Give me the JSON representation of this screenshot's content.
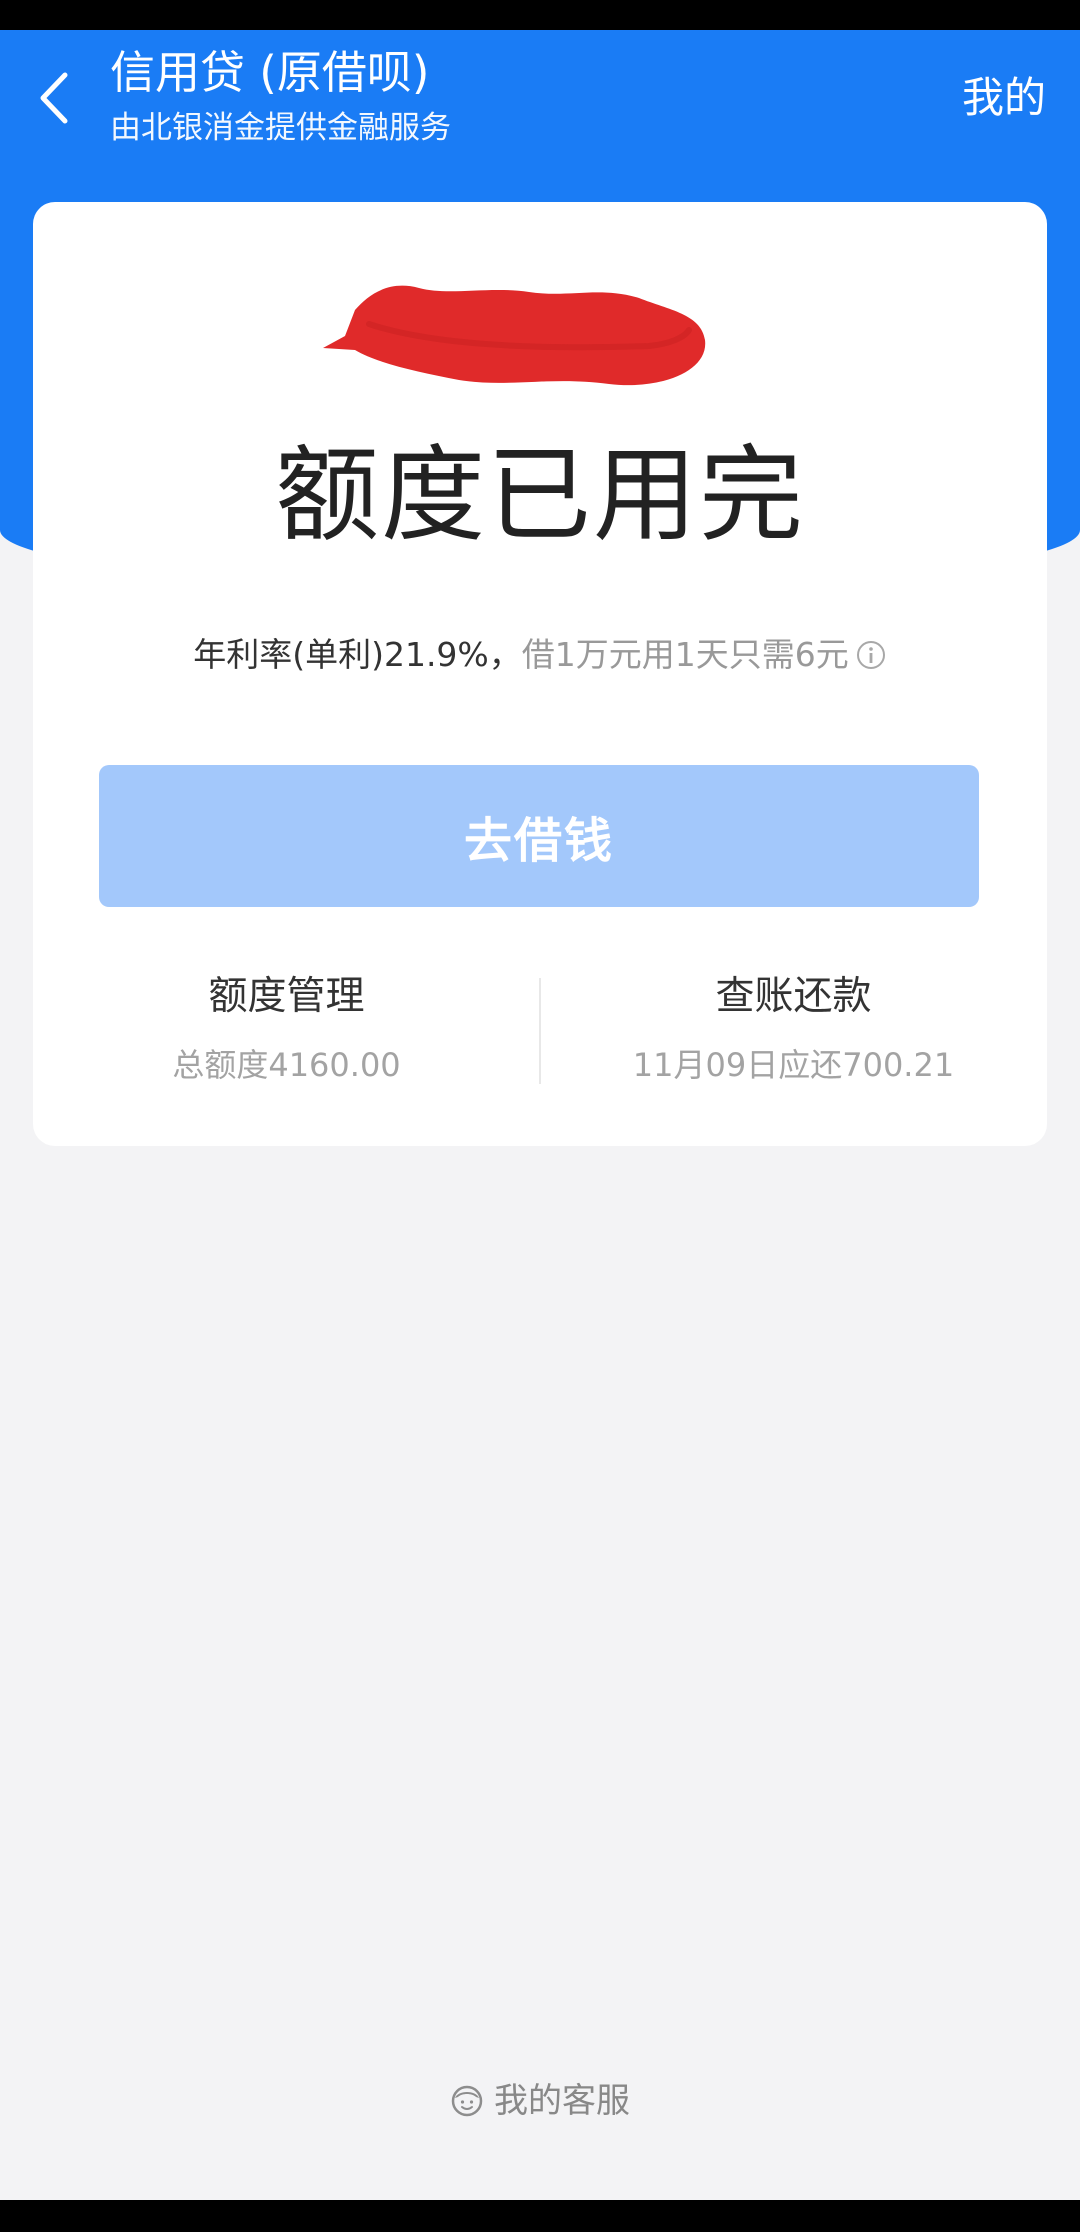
{
  "header": {
    "title": "信用贷 (原借呗)",
    "subtitle": "由北银消金提供金融服务",
    "mine_label": "我的"
  },
  "card": {
    "status": "额度已用完",
    "rate_main": "年利率(单利)21.9%，",
    "rate_sub": "借1万元用1天只需6元",
    "borrow_button": "去借钱",
    "actions": [
      {
        "title": "额度管理",
        "subtitle": "总额度4160.00"
      },
      {
        "title": "查账还款",
        "subtitle": "11月09日应还700.21"
      }
    ]
  },
  "footer": {
    "service_label": "我的客服"
  },
  "colors": {
    "brand_blue": "#1a7cf5",
    "button_disabled": "#a3c8fb",
    "redaction_red": "#e02a2a",
    "background": "#f3f3f5"
  },
  "icons": [
    "back-arrow-icon",
    "info-icon",
    "customer-service-icon"
  ]
}
